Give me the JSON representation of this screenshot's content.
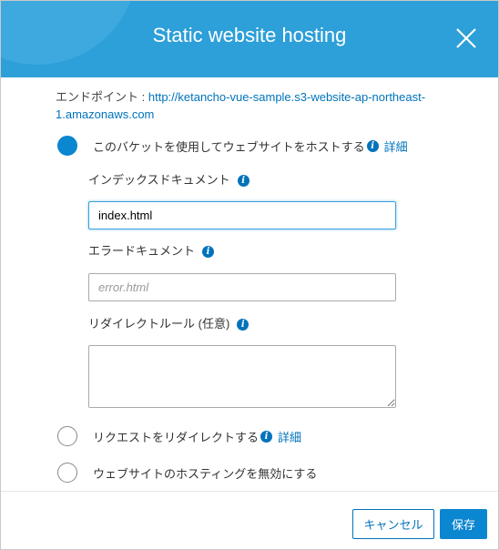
{
  "dialog": {
    "title": "Static website hosting",
    "close_label": "close"
  },
  "endpoint": {
    "label": "エンドポイント :",
    "url": "http://ketancho-vue-sample.s3-website-ap-northeast-1.amazonaws.com"
  },
  "options": {
    "use_bucket": "このバケットを使用してウェブサイトをホストする",
    "use_bucket_link": "詳細",
    "redirect": "リクエストをリダイレクトする",
    "redirect_link": "詳細",
    "disable": "ウェブサイトのホスティングを無効にする"
  },
  "fields": {
    "index_label": "インデックスドキュメント",
    "index_value": "index.html",
    "error_label": "エラードキュメント",
    "error_placeholder": "error.html",
    "redirect_rules_label": "リダイレクトルール (任意)",
    "redirect_rules_value": ""
  },
  "buttons": {
    "cancel": "キャンセル",
    "save": "保存"
  },
  "colors": {
    "header": "#2d9fd9",
    "accent": "#0b86d0",
    "link": "#0073bb"
  },
  "icons": {
    "close": "close-icon",
    "info": "info-icon"
  }
}
